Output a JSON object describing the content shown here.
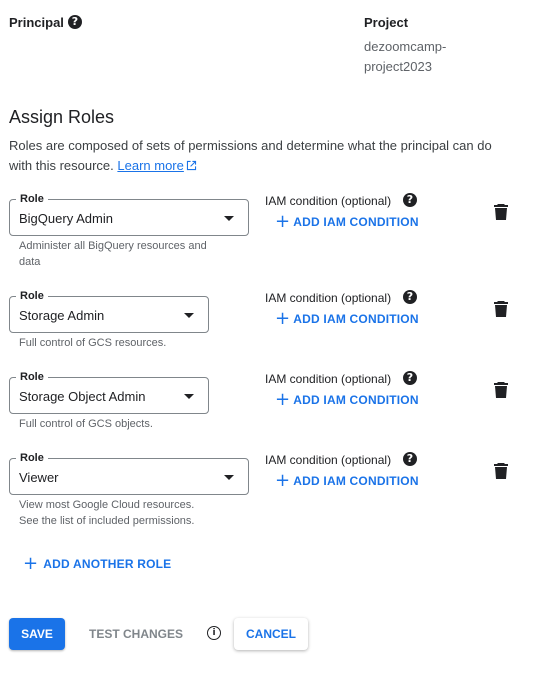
{
  "principal": {
    "label": "Principal",
    "help_icon": "help-icon"
  },
  "project": {
    "label": "Project",
    "value_line1": "dezoomcamp-",
    "value_line2": "project2023"
  },
  "assign_roles": {
    "title": "Assign Roles",
    "description_line1": "Roles are composed of sets of permissions and determine what the principal can do",
    "description_line2": "with this resource.",
    "learn_more": "Learn more"
  },
  "roles": [
    {
      "legend": "Role",
      "value": "BigQuery Admin",
      "helper_line1": "Administer all BigQuery resources and",
      "helper_line2": "data",
      "iam_label": "IAM condition (optional)",
      "add_condition": "ADD IAM CONDITION"
    },
    {
      "legend": "Role",
      "value": "Storage Admin",
      "helper_line1": "Full control of GCS resources.",
      "helper_line2": "",
      "iam_label": "IAM condition (optional)",
      "add_condition": "ADD IAM CONDITION"
    },
    {
      "legend": "Role",
      "value": "Storage Object Admin",
      "helper_line1": "Full control of GCS objects.",
      "helper_line2": "",
      "iam_label": "IAM condition (optional)",
      "add_condition": "ADD IAM CONDITION"
    },
    {
      "legend": "Role",
      "value": "Viewer",
      "helper_line1": "View most Google Cloud resources.",
      "helper_line2": "See the list of included permissions.",
      "iam_label": "IAM condition (optional)",
      "add_condition": "ADD IAM CONDITION"
    }
  ],
  "add_another_role": "ADD ANOTHER ROLE",
  "actions": {
    "save": "SAVE",
    "test_changes": "TEST CHANGES",
    "cancel": "CANCEL"
  },
  "colors": {
    "accent": "#1a73e8",
    "text": "#202124",
    "muted": "#5f6368"
  }
}
